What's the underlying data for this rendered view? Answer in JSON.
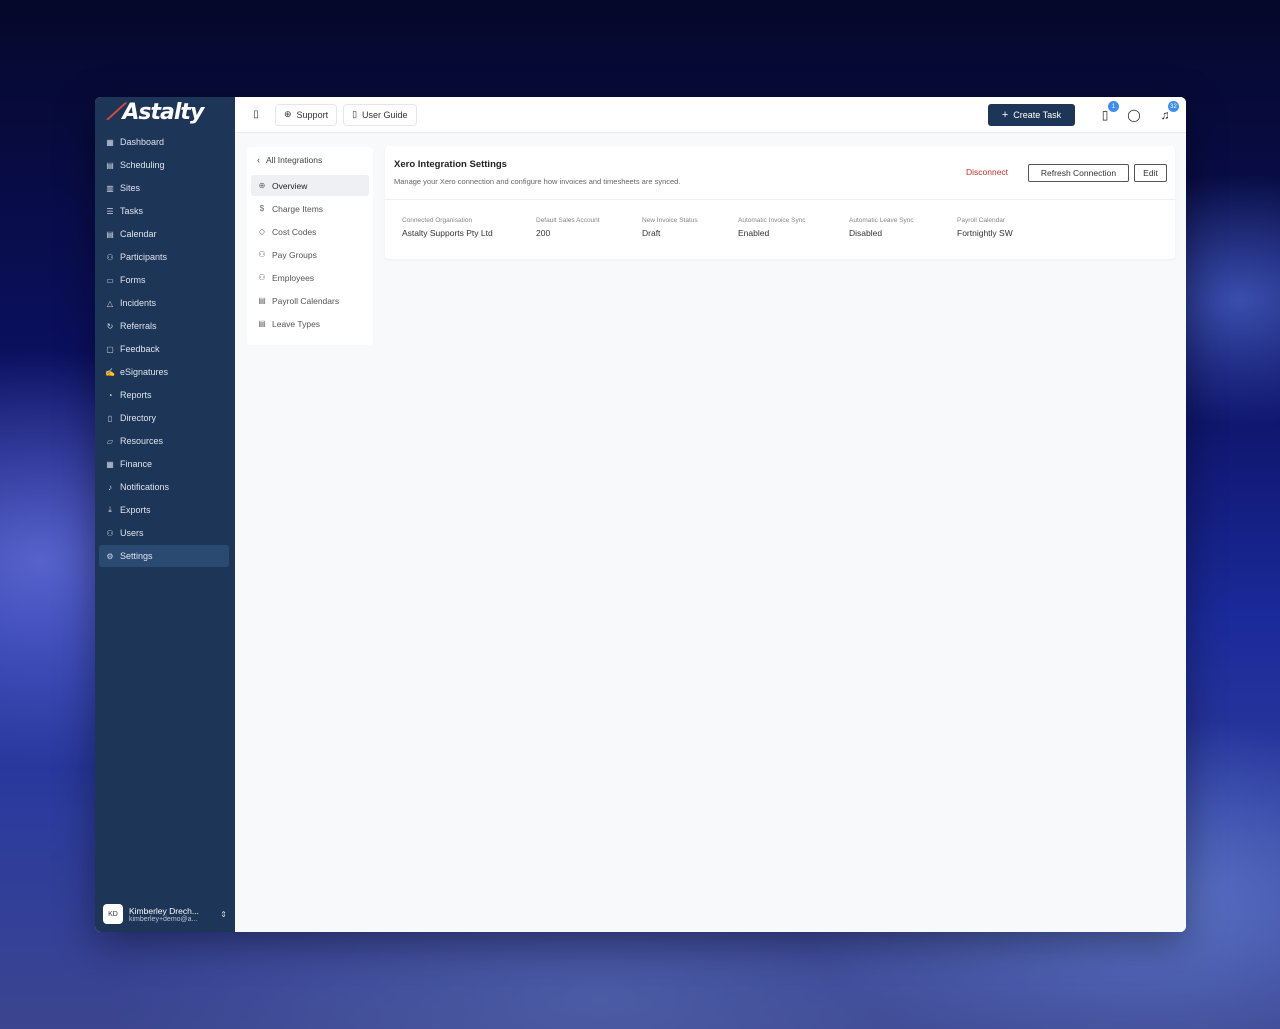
{
  "app": {
    "logo": "Astalty"
  },
  "sidebar": {
    "items": [
      {
        "label": "Dashboard",
        "icon": "grid-icon"
      },
      {
        "label": "Scheduling",
        "icon": "calendar-icon"
      },
      {
        "label": "Sites",
        "icon": "building-icon"
      },
      {
        "label": "Tasks",
        "icon": "list-icon"
      },
      {
        "label": "Calendar",
        "icon": "calendar-icon"
      },
      {
        "label": "Participants",
        "icon": "users-icon"
      },
      {
        "label": "Forms",
        "icon": "form-icon"
      },
      {
        "label": "Incidents",
        "icon": "warning-icon"
      },
      {
        "label": "Referrals",
        "icon": "refresh-icon"
      },
      {
        "label": "Feedback",
        "icon": "message-icon"
      },
      {
        "label": "eSignatures",
        "icon": "signature-icon"
      },
      {
        "label": "Reports",
        "icon": "chart-icon"
      },
      {
        "label": "Directory",
        "icon": "book-icon"
      },
      {
        "label": "Resources",
        "icon": "folder-icon"
      },
      {
        "label": "Finance",
        "icon": "calculator-icon"
      },
      {
        "label": "Notifications",
        "icon": "bell-icon"
      },
      {
        "label": "Exports",
        "icon": "download-icon"
      },
      {
        "label": "Users",
        "icon": "user-icon"
      },
      {
        "label": "Settings",
        "icon": "gear-icon",
        "active": true
      }
    ],
    "user": {
      "initials": "KD",
      "name": "Kimberley Drech...",
      "email": "kimberley+demo@a..."
    }
  },
  "topbar": {
    "support_label": "Support",
    "guide_label": "User Guide",
    "create_task_label": "Create Task",
    "clipboard_badge": "1",
    "bell_badge": "32"
  },
  "subnav": {
    "back_label": "All Integrations",
    "items": [
      {
        "label": "Overview",
        "active": true
      },
      {
        "label": "Charge Items"
      },
      {
        "label": "Cost Codes"
      },
      {
        "label": "Pay Groups"
      },
      {
        "label": "Employees"
      },
      {
        "label": "Payroll Calendars"
      },
      {
        "label": "Leave Types"
      }
    ]
  },
  "card": {
    "title": "Xero Integration Settings",
    "subtitle": "Manage your Xero connection and configure how invoices and timesheets are synced.",
    "disconnect_label": "Disconnect",
    "refresh_label": "Refresh Connection",
    "edit_label": "Edit",
    "fields": [
      {
        "label": "Connected Organisation",
        "value": "Astalty Supports Pty Ltd"
      },
      {
        "label": "Default Sales Account",
        "value": "200"
      },
      {
        "label": "New Invoice Status",
        "value": "Draft"
      },
      {
        "label": "Automatic Invoice Sync",
        "value": "Enabled"
      },
      {
        "label": "Automatic Leave Sync",
        "value": "Disabled"
      },
      {
        "label": "Payroll Calendar",
        "value": "Fortnightly SW"
      }
    ]
  },
  "colors": {
    "sidebar": "#1d3557",
    "accent": "#1d3557",
    "danger": "#c0312b",
    "badge": "#3d8ef0"
  }
}
